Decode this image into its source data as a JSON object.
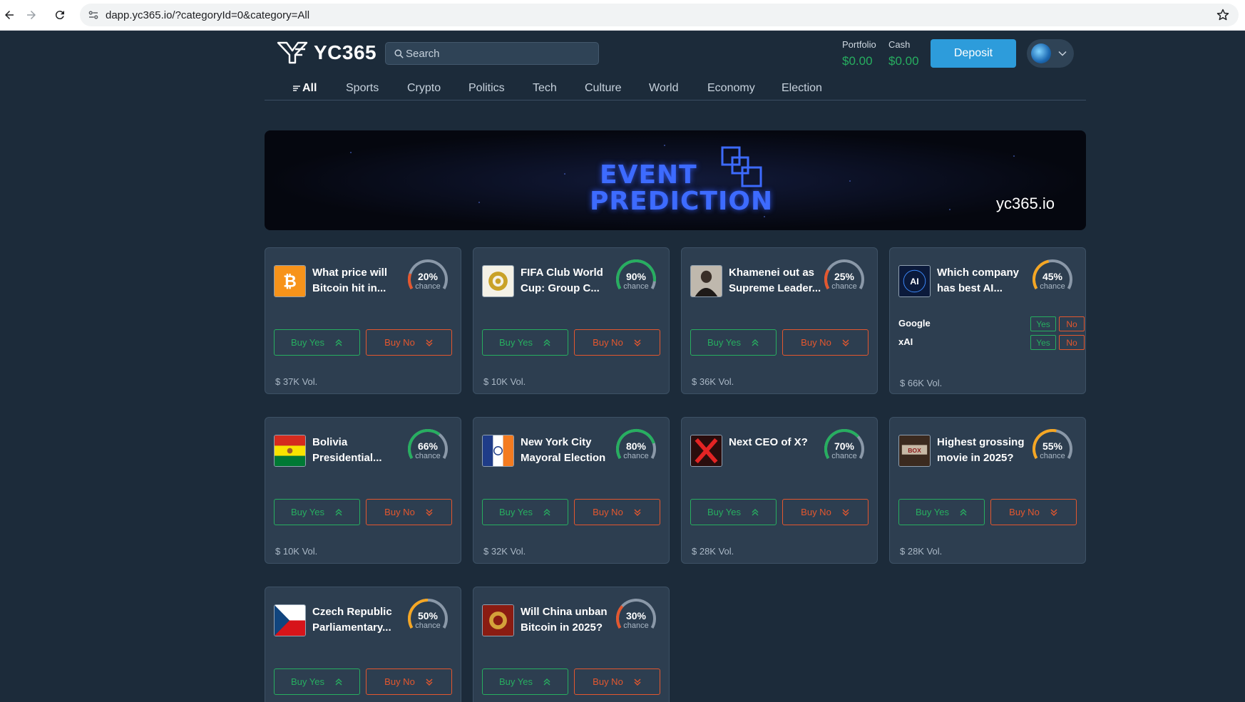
{
  "browser": {
    "url": "dapp.yc365.io/?categoryId=0&category=All"
  },
  "header": {
    "logo_text": "YC365",
    "search_placeholder": "Search",
    "portfolio_label": "Portfolio",
    "portfolio_value": "$0.00",
    "cash_label": "Cash",
    "cash_value": "$0.00",
    "deposit_label": "Deposit"
  },
  "tabs": [
    "All",
    "Sports",
    "Crypto",
    "Politics",
    "Tech",
    "Culture",
    "World",
    "Economy",
    "Election"
  ],
  "banner": {
    "line1": "EVENT",
    "line2": "PREDICTION",
    "site": "yc365.io"
  },
  "colors": {
    "yes": "#27ae60",
    "no": "#e4572e",
    "accent": "#2d9cdb",
    "gauge_red": "#e4572e",
    "gauge_orange": "#f5a623",
    "gauge_green": "#27ae60"
  },
  "chance_label": "chance",
  "buy_yes_label": "Buy Yes",
  "buy_no_label": "Buy No",
  "markets": [
    {
      "title1": "What price will",
      "title2": "Bitcoin hit in...",
      "percent": "20%",
      "chance": 0.2,
      "volume": "$ 37K Vol.",
      "thumb": "bitcoin"
    },
    {
      "title1": "FIFA Club World",
      "title2": "Cup: Group C...",
      "percent": "90%",
      "chance": 0.9,
      "volume": "$ 10K Vol.",
      "thumb": "fifa"
    },
    {
      "title1": "Khamenei out as",
      "title2": "Supreme Leader...",
      "percent": "25%",
      "chance": 0.25,
      "volume": "$ 36K Vol.",
      "thumb": "portrait"
    },
    {
      "title1": "Which company",
      "title2": "has best AI...",
      "percent": "45%",
      "chance": 0.45,
      "volume": "$ 66K Vol.",
      "thumb": "ai",
      "options": [
        {
          "name": "Google",
          "yes": "Yes",
          "no": "No"
        },
        {
          "name": "xAI",
          "yes": "Yes",
          "no": "No"
        }
      ]
    },
    {
      "title1": "Bolivia",
      "title2": "Presidential...",
      "percent": "66%",
      "chance": 0.66,
      "volume": "$ 10K Vol.",
      "thumb": "bolivia"
    },
    {
      "title1": "New York City",
      "title2": "Mayoral Election",
      "percent": "80%",
      "chance": 0.8,
      "volume": "$ 32K Vol.",
      "thumb": "nyc"
    },
    {
      "title1": "Next CEO of X?",
      "title2": "",
      "percent": "70%",
      "chance": 0.7,
      "volume": "$ 28K Vol.",
      "thumb": "x"
    },
    {
      "title1": "Highest grossing",
      "title2": "movie in 2025?",
      "percent": "55%",
      "chance": 0.55,
      "volume": "$ 28K Vol.",
      "thumb": "movie"
    },
    {
      "title1": "Czech Republic",
      "title2": "Parliamentary...",
      "percent": "50%",
      "chance": 0.5,
      "volume": "",
      "thumb": "czech"
    },
    {
      "title1": "Will China unban",
      "title2": "Bitcoin in 2025?",
      "percent": "30%",
      "chance": 0.3,
      "volume": "",
      "thumb": "china"
    }
  ]
}
